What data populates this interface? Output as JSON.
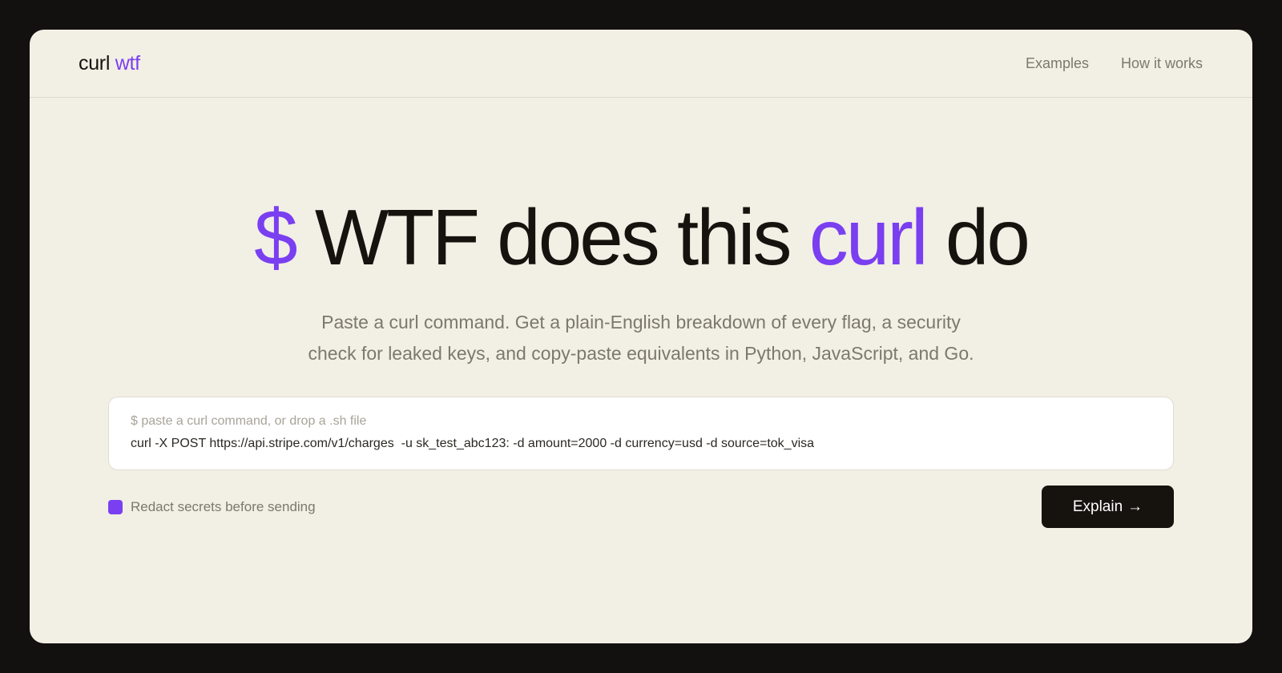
{
  "header": {
    "logo_part1": "curl",
    "logo_part2": "wtf",
    "nav": [
      {
        "label": "Examples"
      },
      {
        "label": "How it works"
      }
    ]
  },
  "hero": {
    "prompt_symbol": "$",
    "title_part1": "WTF does this",
    "title_accent": "curl",
    "title_part2": "do",
    "subtitle_line1": "Paste a curl command. Get a plain-English breakdown of every flag, a security",
    "subtitle_line2": "check for leaked keys, and copy-paste equivalents in Python, JavaScript, and Go."
  },
  "input": {
    "placeholder": "$ paste a curl command, or drop a .sh file",
    "value": "curl -X POST https://api.stripe.com/v1/charges  -u sk_test_abc123: -d amount=2000 -d currency=usd -d source=tok_visa"
  },
  "options": {
    "redact_label": "Redact secrets before sending",
    "redact_checked": true
  },
  "actions": {
    "explain_label": "Explain",
    "explain_arrow": "→"
  },
  "colors": {
    "accent": "#7a3ff0",
    "background": "#121110",
    "card": "#f2efe5",
    "button": "#16130f"
  }
}
